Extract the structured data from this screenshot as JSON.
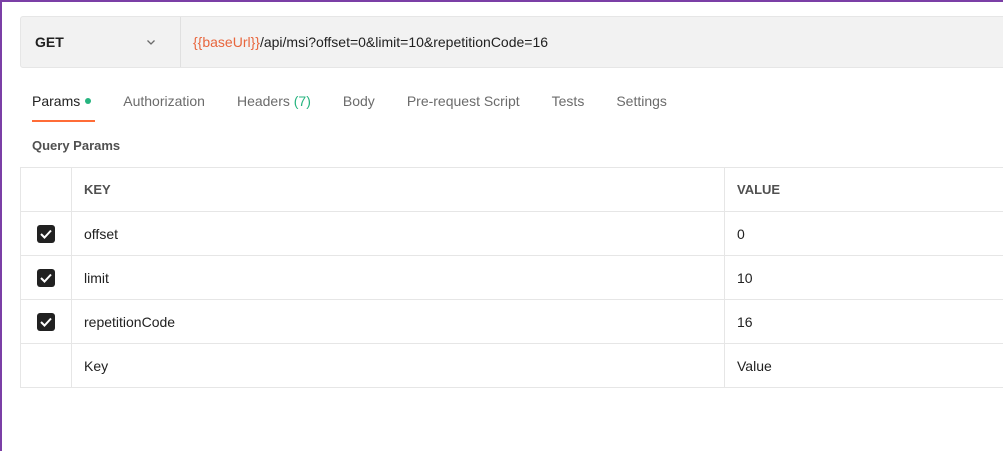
{
  "request": {
    "method": "GET",
    "url_variable": "{{baseUrl}}",
    "url_path": "/api/msi?offset=0&limit=10&repetitionCode=16"
  },
  "tabs": [
    {
      "label": "Params",
      "active": true,
      "indicator": "green-dot"
    },
    {
      "label": "Authorization"
    },
    {
      "label": "Headers",
      "count": "(7)"
    },
    {
      "label": "Body"
    },
    {
      "label": "Pre-request Script"
    },
    {
      "label": "Tests"
    },
    {
      "label": "Settings"
    }
  ],
  "query_params": {
    "title": "Query Params",
    "columns": {
      "key": "KEY",
      "value": "VALUE"
    },
    "rows": [
      {
        "checked": true,
        "key": "offset",
        "value": "0"
      },
      {
        "checked": true,
        "key": "limit",
        "value": "10"
      },
      {
        "checked": true,
        "key": "repetitionCode",
        "value": "16"
      }
    ],
    "new_row": {
      "key_placeholder": "Key",
      "value_placeholder": "Value"
    }
  },
  "colors": {
    "accent": "#ff6c37",
    "variable": "#e8663d",
    "indicator": "#26b47f",
    "frame": "#7b3fa6"
  }
}
